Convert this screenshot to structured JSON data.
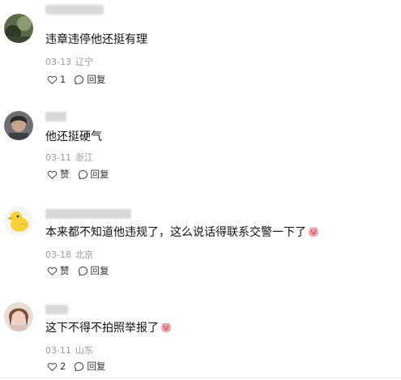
{
  "comments": [
    {
      "avatar": "avatar-green-dark",
      "text": "违章违停他还挺有理",
      "date": "03-13",
      "location": "辽宁",
      "like_label": "1",
      "reply_label": "回复"
    },
    {
      "avatar": "avatar-person-dark",
      "text": "他还挺硬气",
      "date": "03-11",
      "location": "浙江",
      "like_label": "赞",
      "reply_label": "回复"
    },
    {
      "avatar": "avatar-yellow-duck",
      "text": "本来都不知道他违规了，这么说话得联系交警一下了",
      "date": "03-18",
      "location": "北京",
      "like_label": "赞",
      "reply_label": "回复"
    },
    {
      "avatar": "avatar-person-light",
      "text": "这下不得不拍照举报了",
      "date": "03-11",
      "location": "山东",
      "like_label": "2",
      "reply_label": "回复"
    }
  ],
  "icons": {
    "like": "heart-icon",
    "reply": "comment-bubble-icon",
    "emoji": "pig-face-emoji"
  }
}
